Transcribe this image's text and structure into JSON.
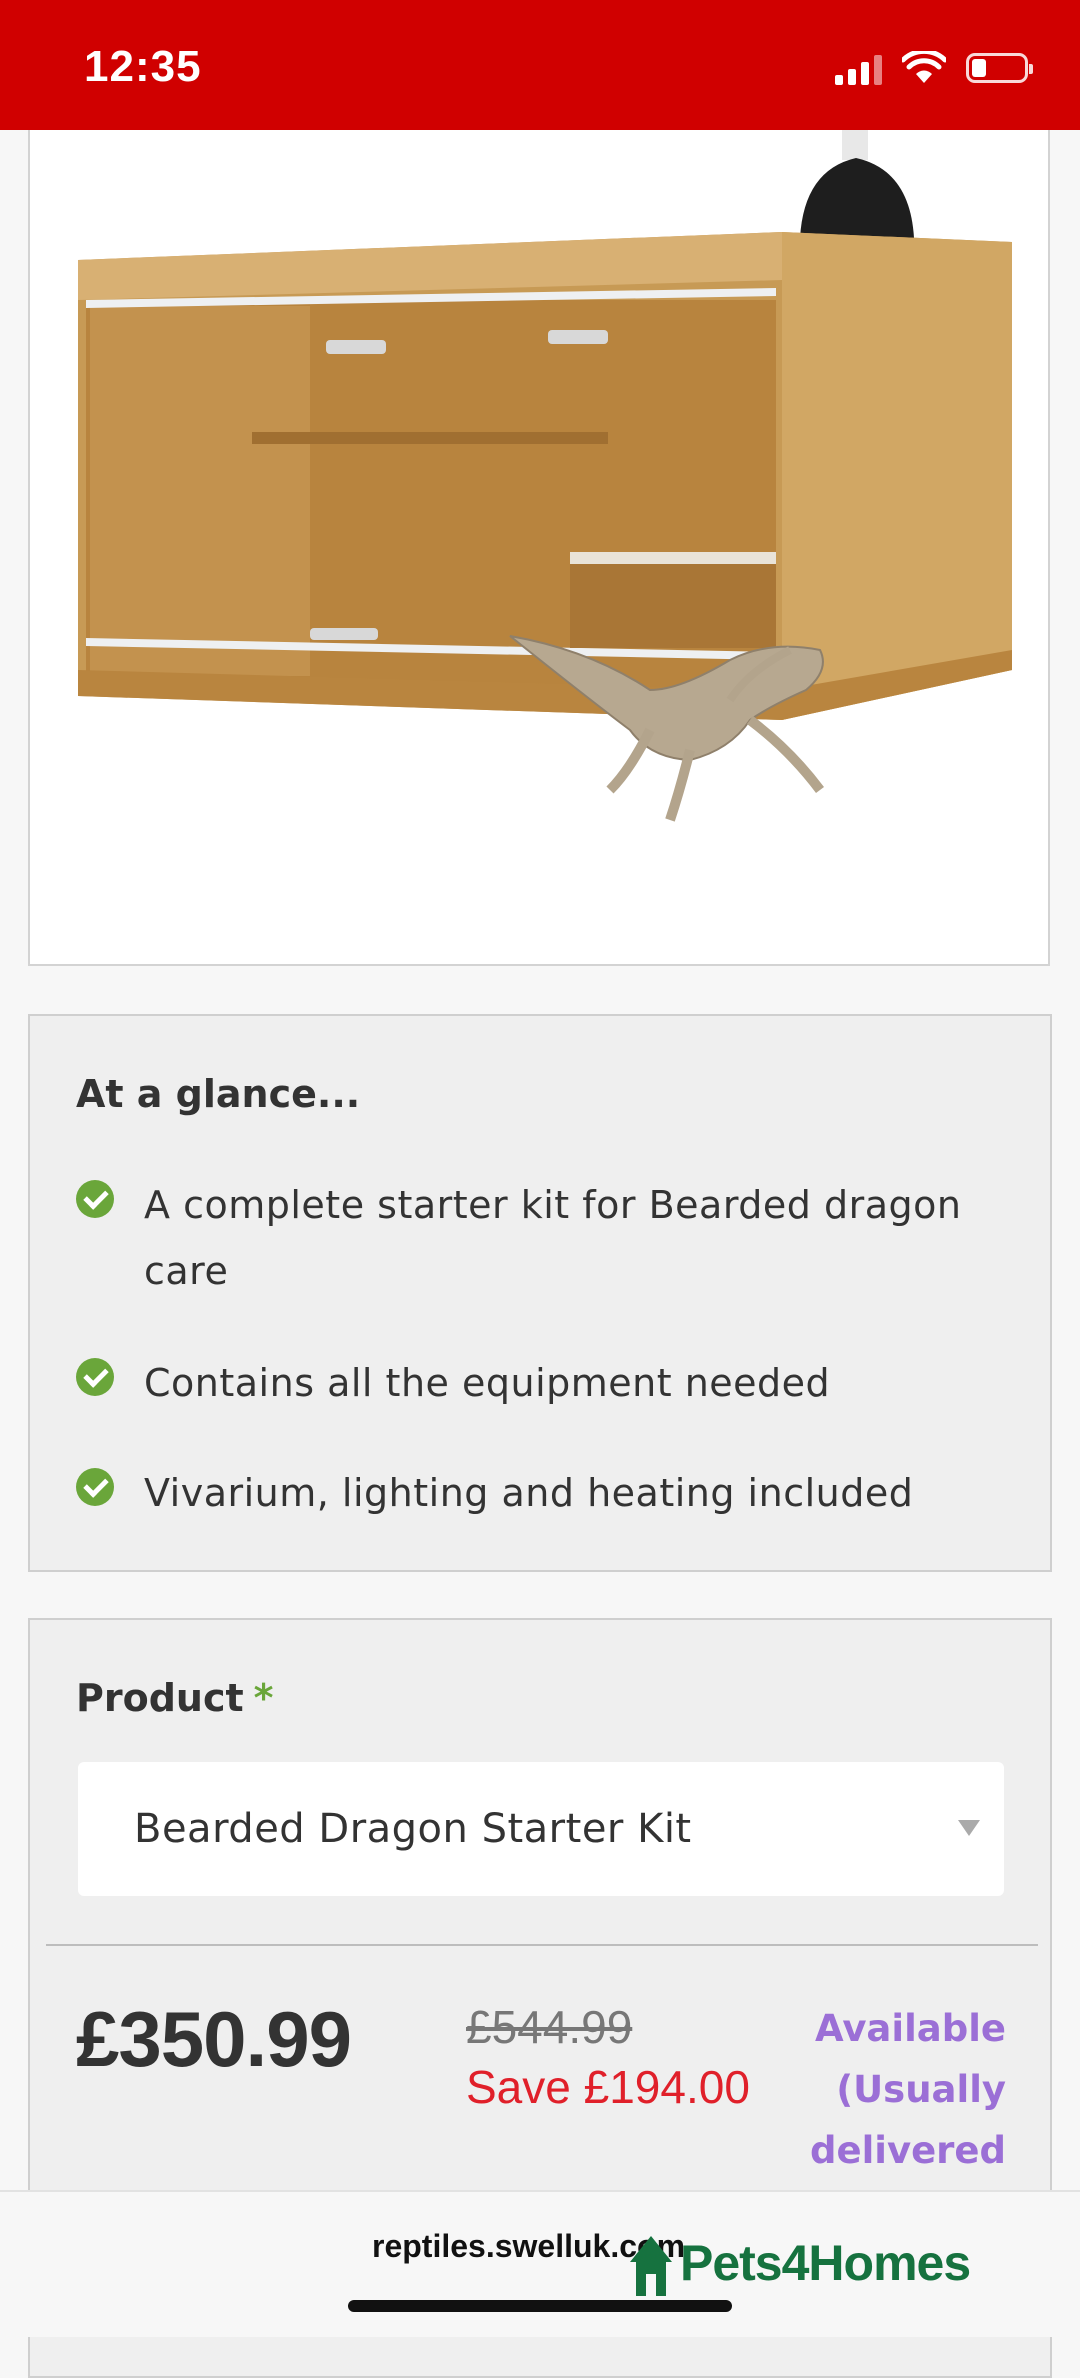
{
  "status_bar": {
    "time": "12:35"
  },
  "product_image": {
    "alt": "Wooden vivarium with heat lamp and bearded dragon"
  },
  "glance": {
    "title": "At a glance...",
    "items": [
      {
        "text": "A complete starter kit for Bearded dragon care"
      },
      {
        "text": "Contains all the equipment needed"
      },
      {
        "text": "Vivarium, lighting and heating included"
      }
    ]
  },
  "product": {
    "label": "Product",
    "required_mark": "*",
    "selected": "Bearded Dragon Starter Kit",
    "price": "£350.99",
    "old_price": "£544.99",
    "save": "Save £194.00",
    "availability": "Available (Usually delivered"
  },
  "browser": {
    "url": "reptiles.swelluk.com",
    "logo_text": "Pets4Homes"
  },
  "colors": {
    "status_bar": "#d00000",
    "check": "#6aa63a",
    "save": "#e0202a",
    "availability": "#9b6fd6",
    "logo": "#16723f"
  }
}
